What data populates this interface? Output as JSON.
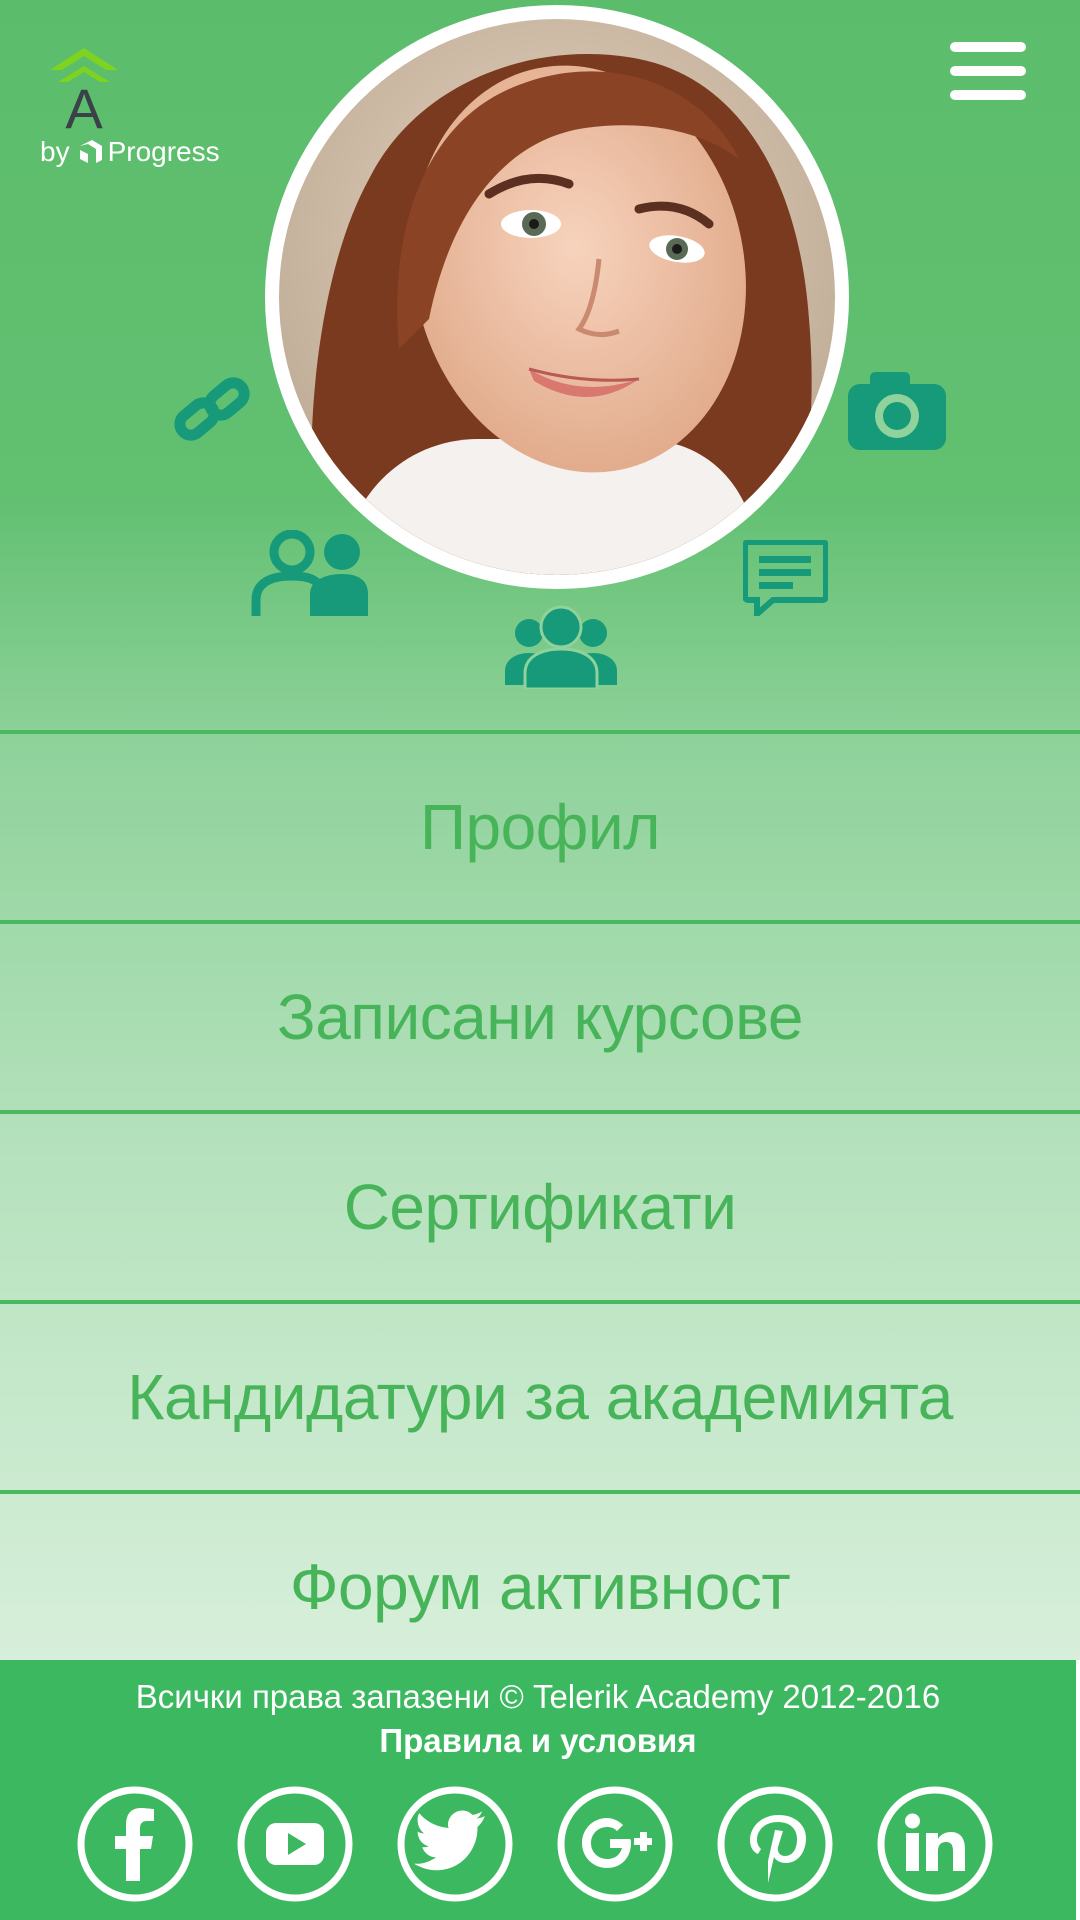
{
  "header": {
    "logo_letter": "A",
    "by_text": "by",
    "brand_text": "Progress"
  },
  "profile": {
    "photo": "profile-photo"
  },
  "icons": {
    "link": "link-icon",
    "camera": "camera-icon",
    "users": "users-icon",
    "message": "message-icon",
    "group": "group-icon",
    "color": "#179a7a"
  },
  "menu": {
    "items": [
      {
        "label": "Профил"
      },
      {
        "label": "Записани курсове"
      },
      {
        "label": "Сертификати"
      },
      {
        "label": "Кандидатури за академията"
      },
      {
        "label": "Форум активност"
      }
    ]
  },
  "footer": {
    "copyright": "Всички права запазени © Telerik Academy 2012-2016",
    "terms": "Правила и условия",
    "social": [
      "facebook-icon",
      "youtube-icon",
      "twitter-icon",
      "google-plus-icon",
      "pinterest-icon",
      "linkedin-icon"
    ]
  },
  "colors": {
    "brand_green": "#3cb960",
    "menu_text": "#47b45a",
    "accent_teal": "#179a7a"
  }
}
